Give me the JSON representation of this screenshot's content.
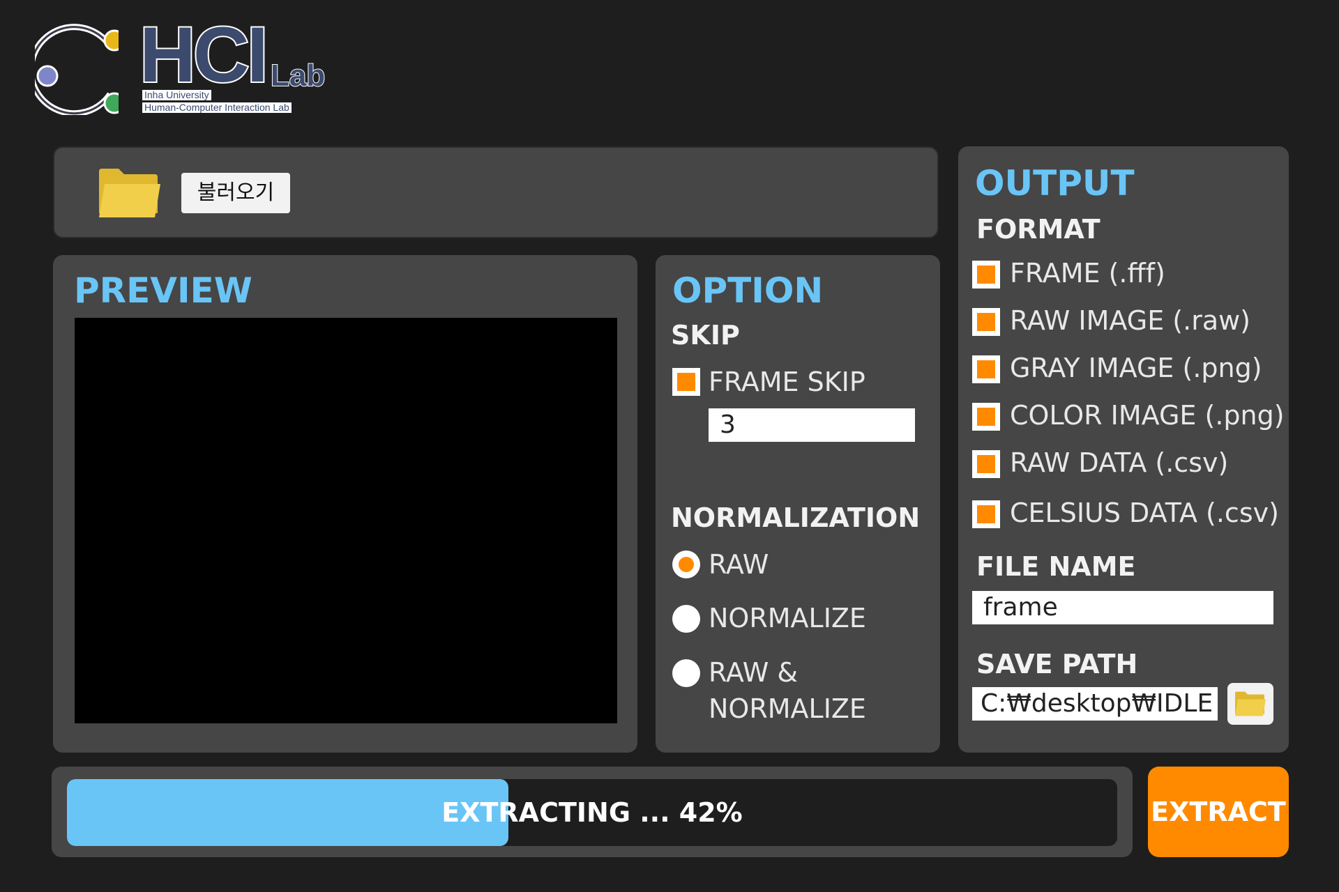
{
  "logo": {
    "title": "HCI",
    "suffix": "Lab",
    "line1": "Inha University",
    "line2": "Human-Computer Interaction Lab"
  },
  "toolbar": {
    "load_label": "불러오기"
  },
  "preview": {
    "title": "PREVIEW"
  },
  "option": {
    "title": "OPTION",
    "skip_heading": "SKIP",
    "frame_skip_label": "FRAME SKIP",
    "frame_skip_value": "3",
    "normalization_heading": "NORMALIZATION",
    "radios": [
      {
        "label": "RAW",
        "selected": true
      },
      {
        "label": "NORMALIZE",
        "selected": false
      },
      {
        "label_line1": "RAW &",
        "label_line2": "NORMALIZE",
        "selected": false
      }
    ]
  },
  "output": {
    "title": "OUTPUT",
    "format_heading": "FORMAT",
    "formats": [
      {
        "label": "FRAME (.fff)",
        "checked": true
      },
      {
        "label": "RAW IMAGE (.raw)",
        "checked": true
      },
      {
        "label": "GRAY IMAGE (.png)",
        "checked": true
      },
      {
        "label": "COLOR IMAGE (.png)",
        "checked": true
      },
      {
        "label": "RAW DATA (.csv)",
        "checked": true
      },
      {
        "label": "CELSIUS DATA (.csv)",
        "checked": true
      }
    ],
    "file_name_heading": "FILE NAME",
    "file_name_value": "frame",
    "save_path_heading": "SAVE PATH",
    "save_path_value": "C:₩desktop₩IDLE"
  },
  "progress": {
    "label": "EXTRACTING ... 42%",
    "percent": 42
  },
  "extract_button": {
    "label": "EXTRACT"
  },
  "colors": {
    "background": "#1e1e1e",
    "panel": "#464646",
    "accent_blue": "#6ac5f7",
    "accent_orange": "#ff8a00",
    "folder_yellow": "#f2cf4a"
  },
  "icons": {
    "folder": "folder-icon",
    "folder_small": "folder-icon"
  }
}
